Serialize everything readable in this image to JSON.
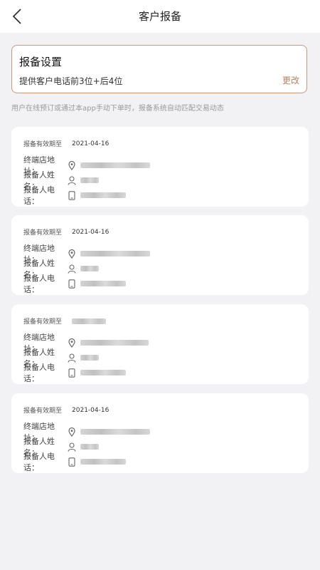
{
  "header": {
    "title": "客户报备",
    "back_icon": "chevron-left-icon"
  },
  "settings": {
    "title": "报备设置",
    "description": "提供客户电话前3位+后4位",
    "change_label": "更改",
    "border_color": "#C9987F",
    "accent_color": "#B7835E"
  },
  "hint": "用户在线预订或通过本app手动下单时，报备系统自动匹配交易动态",
  "records": [
    {
      "expiry_label": "报备有效期至",
      "expiry_date": "2021-04-16",
      "store_label": "终端店地址：",
      "name_label": "报备人姓名：",
      "phone_label": "报备人电话："
    },
    {
      "expiry_label": "报备有效期至",
      "expiry_date": "2021-04-16",
      "store_label": "终端店地址：",
      "name_label": "报备人姓名：",
      "phone_label": "报备人电话："
    },
    {
      "expiry_label": "报备有效期至",
      "expiry_date": "",
      "store_label": "终端店地址：",
      "name_label": "报备人姓名：",
      "phone_label": "报备人电话："
    },
    {
      "expiry_label": "报备有效期至",
      "expiry_date": "2021-04-16",
      "store_label": "终端店地址：",
      "name_label": "报备人姓名：",
      "phone_label": "报备人电话："
    }
  ],
  "icons": {
    "store": "location-pin-icon",
    "name": "person-icon",
    "phone": "phone-icon"
  }
}
